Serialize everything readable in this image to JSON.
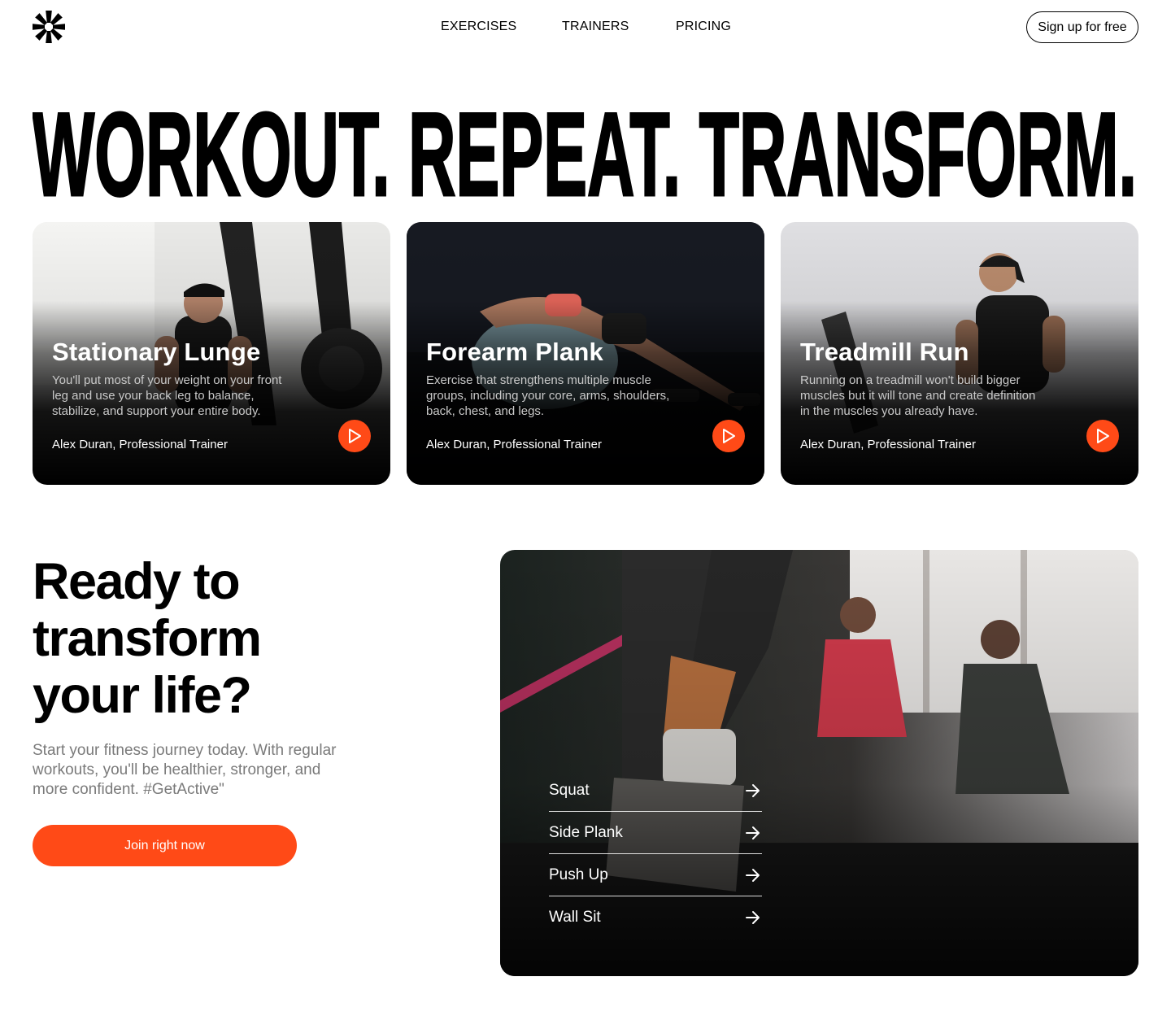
{
  "header": {
    "logo_icon": "asterisk-logo-icon",
    "nav": [
      {
        "label": "EXERCISES"
      },
      {
        "label": "TRAINERS"
      },
      {
        "label": "PRICING"
      }
    ],
    "signup_label": "Sign up for free"
  },
  "hero_headline": "WORKOUT. REPEAT. TRANSFORM.",
  "cards": [
    {
      "title": "Stationary Lunge",
      "description": "You'll put most of your weight on your front leg and use your back leg to balance, stabilize, and support your entire body.",
      "author": "Alex Duran, Professional Trainer",
      "play_icon": "play-icon"
    },
    {
      "title": "Forearm Plank",
      "description": "Exercise that strengthens multiple muscle groups, including your core, arms, shoulders, back, chest, and legs.",
      "author": "Alex Duran, Professional Trainer",
      "play_icon": "play-icon"
    },
    {
      "title": "Treadmill Run",
      "description": "Running on a treadmill won't build bigger muscles but it will tone and create definition in the muscles you already have.",
      "author": "Alex Duran, Professional Trainer",
      "play_icon": "play-icon"
    }
  ],
  "cta": {
    "title_lines": [
      "Ready to",
      "transform",
      "your life?"
    ],
    "text": "Start your fitness journey today. With regular workouts, you'll be healthier, stronger, and more confident. #GetActive\"",
    "button_label": "Join right now"
  },
  "exercise_list": [
    {
      "label": "Squat"
    },
    {
      "label": "Side Plank"
    },
    {
      "label": "Push Up"
    },
    {
      "label": "Wall Sit"
    }
  ],
  "colors": {
    "accent": "#ff4a17",
    "text": "#000000",
    "muted_text": "#7a7a7a",
    "background": "#ffffff"
  }
}
